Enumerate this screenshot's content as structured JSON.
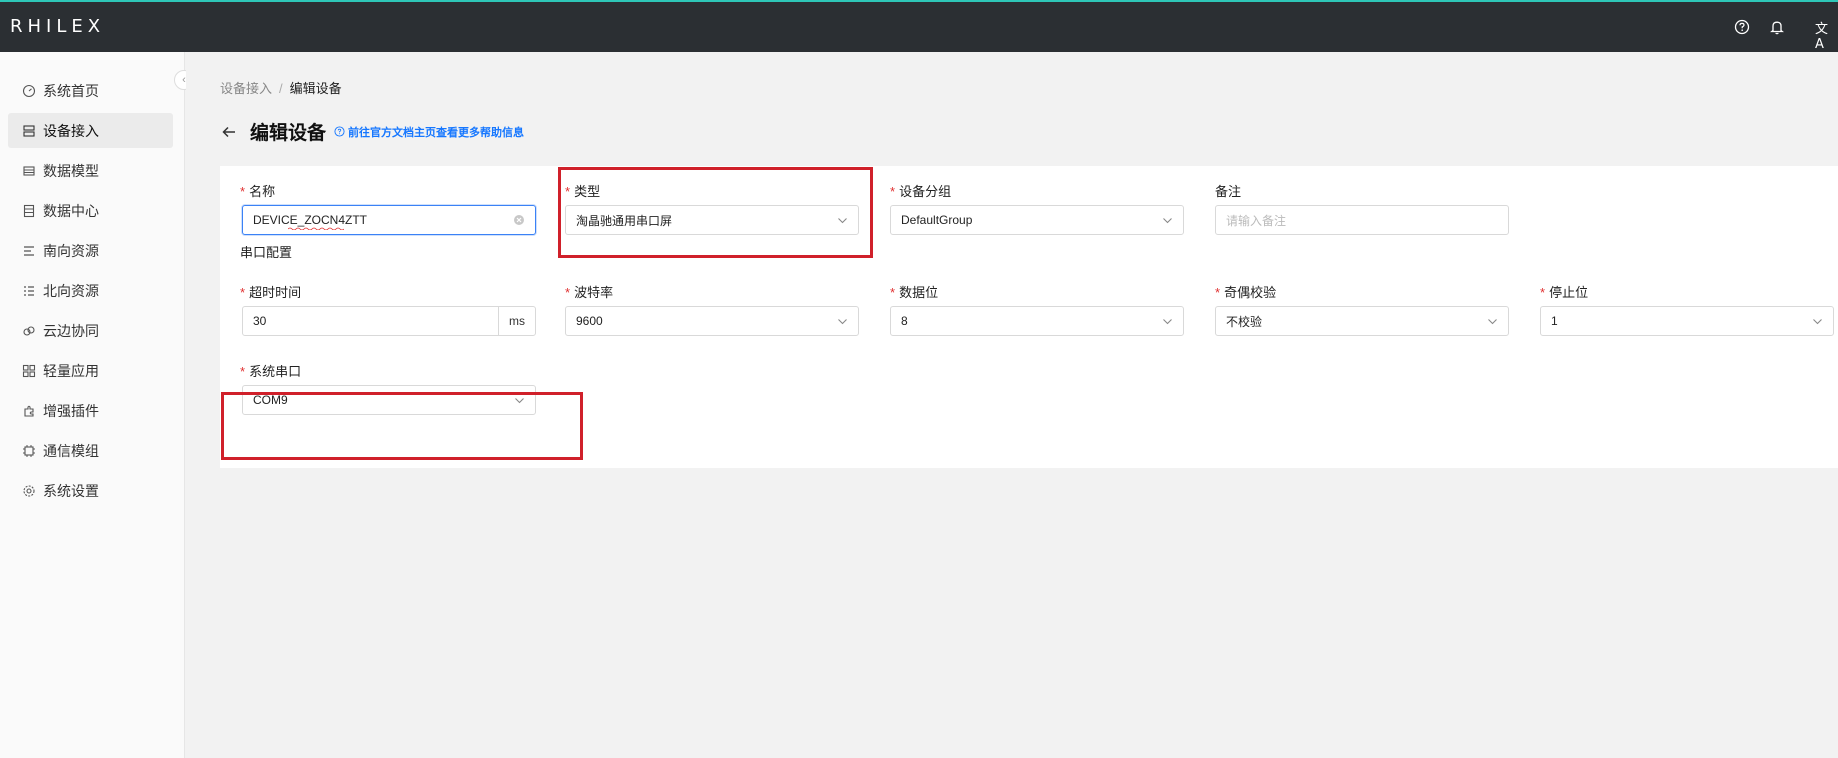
{
  "app": {
    "logo": "RHILEX"
  },
  "header": {
    "icons": [
      "help-icon",
      "bell-icon",
      "translate-icon"
    ],
    "translate_glyph": "文A"
  },
  "sidebar": {
    "items": [
      {
        "label": "系统首页",
        "icon": "dashboard-icon",
        "active": false
      },
      {
        "label": "设备接入",
        "icon": "devices-icon",
        "active": true
      },
      {
        "label": "数据模型",
        "icon": "model-icon",
        "active": false
      },
      {
        "label": "数据中心",
        "icon": "datacenter-icon",
        "active": false
      },
      {
        "label": "南向资源",
        "icon": "south-icon",
        "active": false
      },
      {
        "label": "北向资源",
        "icon": "north-icon",
        "active": false
      },
      {
        "label": "云边协同",
        "icon": "cloud-icon",
        "active": false
      },
      {
        "label": "轻量应用",
        "icon": "apps-icon",
        "active": false
      },
      {
        "label": "增强插件",
        "icon": "plugin-icon",
        "active": false
      },
      {
        "label": "通信模组",
        "icon": "chip-icon",
        "active": false
      },
      {
        "label": "系统设置",
        "icon": "gear-icon",
        "active": false
      }
    ]
  },
  "breadcrumb": {
    "parent": "设备接入",
    "separator": "/",
    "current": "编辑设备"
  },
  "page": {
    "title": "编辑设备",
    "help_link": "前往官方文档主页查看更多帮助信息"
  },
  "form": {
    "name": {
      "label": "名称",
      "value": "DEVICE_ZOCN4ZTT"
    },
    "type": {
      "label": "类型",
      "value": "淘晶驰通用串口屏"
    },
    "group": {
      "label": "设备分组",
      "value": "DefaultGroup"
    },
    "remark": {
      "label": "备注",
      "placeholder": "请输入备注"
    },
    "serial_section": "串口配置",
    "timeout": {
      "label": "超时时间",
      "value": "30",
      "unit": "ms"
    },
    "baud": {
      "label": "波特率",
      "value": "9600"
    },
    "databits": {
      "label": "数据位",
      "value": "8"
    },
    "parity": {
      "label": "奇偶校验",
      "value": "不校验"
    },
    "stopbits": {
      "label": "停止位",
      "value": "1"
    },
    "port": {
      "label": "系统串口",
      "value": "COM9"
    }
  },
  "colors": {
    "header_bg": "#2b2f33",
    "accent_line": "#2ec7b8",
    "required": "#e03030",
    "link": "#1677ff",
    "highlight": "#d0202a"
  }
}
